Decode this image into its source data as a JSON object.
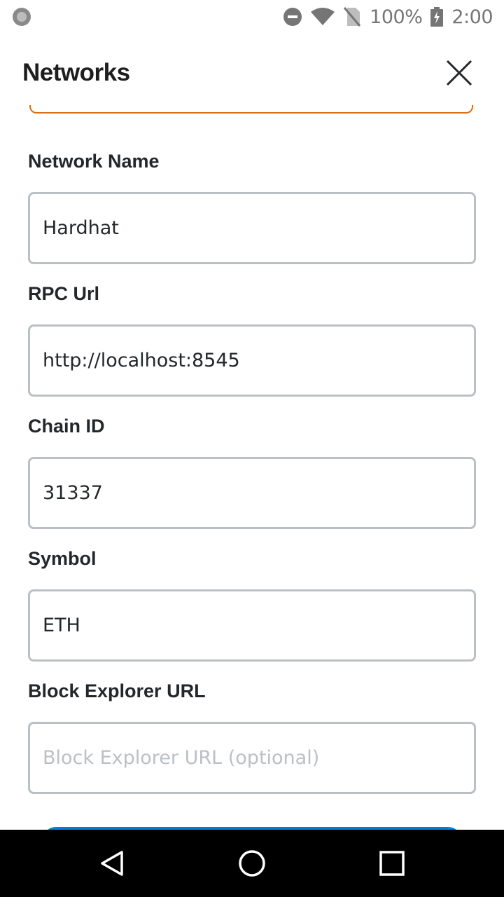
{
  "status_bar": {
    "battery_text": "100%",
    "time": "2:00",
    "icons": [
      "notification-dot-icon",
      "do-not-disturb-icon",
      "wifi-icon",
      "no-sim-icon",
      "battery-charging-icon"
    ]
  },
  "header": {
    "title": "Networks",
    "close_icon": "close-icon"
  },
  "form": {
    "network_name": {
      "label": "Network Name",
      "value": "Hardhat",
      "placeholder": ""
    },
    "rpc_url": {
      "label": "RPC Url",
      "value": "http://localhost:8545",
      "placeholder": ""
    },
    "chain_id": {
      "label": "Chain ID",
      "value": "31337",
      "placeholder": ""
    },
    "symbol": {
      "label": "Symbol",
      "value": "ETH",
      "placeholder": ""
    },
    "block_explorer_url": {
      "label": "Block Explorer URL",
      "value": "",
      "placeholder": "Block Explorer URL (optional)"
    }
  },
  "nav_bar": {
    "icons": [
      "back-icon",
      "home-icon",
      "recents-icon"
    ]
  },
  "colors": {
    "input_border": "#bbc0c5",
    "focused_border": "#d4731c",
    "text": "#24272a",
    "placeholder": "#bbc0c5",
    "primary_button": "#037dd6"
  }
}
